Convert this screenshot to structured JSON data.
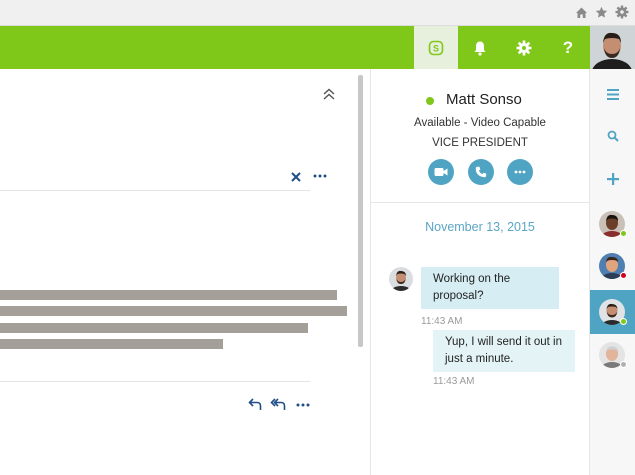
{
  "browser": {
    "icons": [
      "home-icon",
      "star-icon",
      "gear-icon"
    ]
  },
  "topbar": {
    "color": "#7fc81a",
    "buttons": [
      "skype-icon",
      "bell-icon",
      "settings-gear-icon",
      "help-icon"
    ],
    "help_label": "?"
  },
  "contact": {
    "name": "Matt Sonso",
    "status": "Available - Video Capable",
    "title": "VICE PRESIDENT",
    "presence_color": "#7fc81a",
    "actions": [
      "video-call-icon",
      "phone-call-icon",
      "more-options-icon"
    ]
  },
  "conversation": {
    "date": "November 13, 2015",
    "messages": [
      {
        "direction": "incoming",
        "text": "Working on the proposal?",
        "time": "11:43 AM"
      },
      {
        "direction": "outgoing",
        "text": "Yup, I will send it out in just a minute.",
        "time": "11:43 AM"
      }
    ]
  },
  "rail": {
    "icons": [
      "menu-icon",
      "search-icon",
      "add-icon"
    ],
    "contacts": [
      {
        "presence": "#7fc81a"
      },
      {
        "presence": "#d0021b"
      },
      {
        "presence": "#7fc81a",
        "selected": true
      },
      {
        "presence": "#b0b0b0"
      }
    ],
    "selected_color": "#4fa4c3"
  },
  "left": {
    "toolbar_icons": [
      "collapse-up-icon",
      "close-icon",
      "more-icon"
    ],
    "footer_icons": [
      "reply-icon",
      "reply-all-icon",
      "more-icon"
    ]
  }
}
